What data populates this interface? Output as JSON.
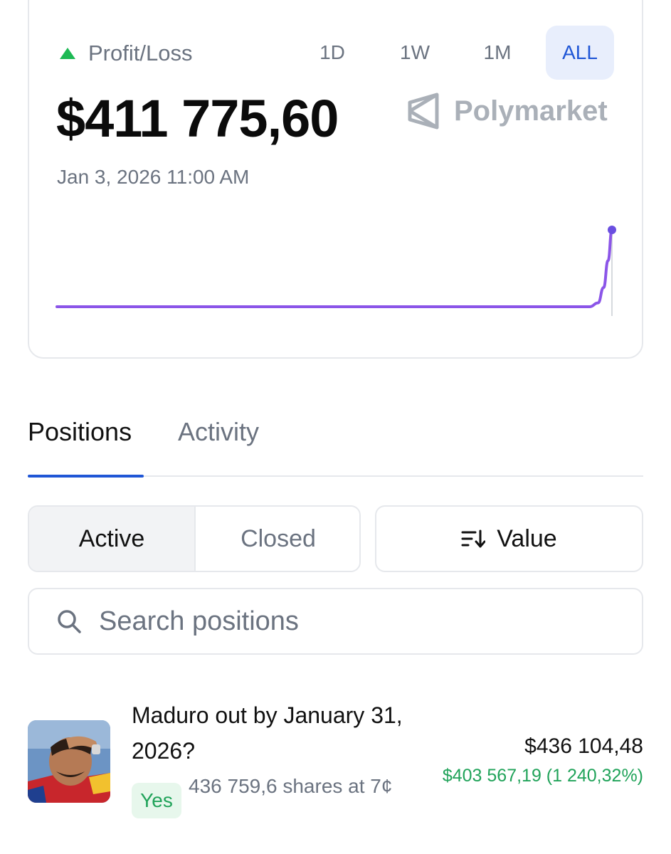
{
  "pnl_card": {
    "label": "Profit/Loss",
    "trend": "up",
    "value": "$411 775,60",
    "timestamp": "Jan 3, 2026 11:00 AM",
    "brand": "Polymarket",
    "range_tabs": [
      {
        "label": "1D",
        "active": false
      },
      {
        "label": "1W",
        "active": false
      },
      {
        "label": "1M",
        "active": false
      },
      {
        "label": "ALL",
        "active": true
      }
    ]
  },
  "chart_data": {
    "type": "line",
    "x": [
      0,
      10,
      20,
      30,
      40,
      50,
      60,
      70,
      80,
      90,
      93,
      96,
      97.5,
      98.5,
      99.3,
      100
    ],
    "values": [
      0,
      0,
      0,
      0,
      0,
      0,
      0,
      0,
      0,
      0,
      0,
      0,
      0.05,
      0.25,
      0.6,
      1.0
    ],
    "title": "",
    "xlabel": "",
    "ylabel": "",
    "grid": false,
    "line_color": "#8b55e8",
    "marker_color": "#6a4fe0"
  },
  "tabs": [
    {
      "label": "Positions",
      "active": true
    },
    {
      "label": "Activity",
      "active": false
    }
  ],
  "filter": {
    "segments": [
      {
        "label": "Active",
        "active": true
      },
      {
        "label": "Closed",
        "active": false
      }
    ],
    "sort_label": "Value",
    "sort_icon": "sort-descending-icon"
  },
  "search": {
    "placeholder": "Search positions",
    "value": ""
  },
  "positions": [
    {
      "title": "Maduro out by January 31, 2026?",
      "outcome": "Yes",
      "shares": "436 759,6 shares at 7¢",
      "value": "$436 104,48",
      "pnl": "$403 567,19 (1 240,32%)"
    }
  ],
  "colors": {
    "accent": "#1f56d6",
    "positive": "#21a35a",
    "chart_line": "#8b55e8",
    "muted_text": "#6b7380"
  }
}
